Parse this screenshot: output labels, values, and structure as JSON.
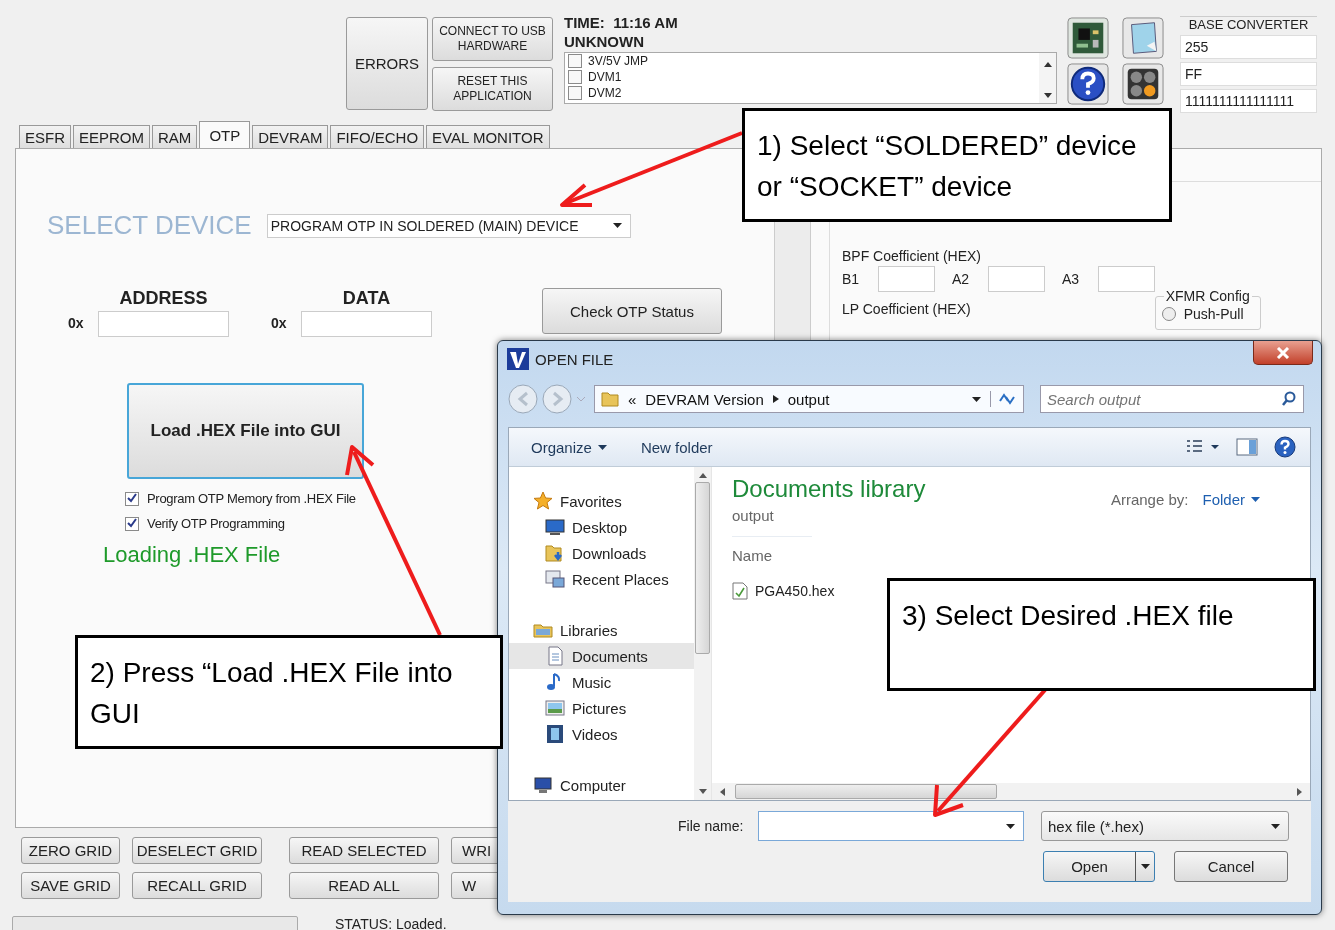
{
  "top_bar": {
    "errors_button": "ERRORS",
    "connect_button": "CONNECT TO USB HARDWARE",
    "reset_button": "RESET THIS APPLICATION",
    "time": "TIME:  11:16 AM",
    "device_state": "UNKNOWN",
    "checklist": [
      {
        "label": "3V/5V JMP",
        "checked": false
      },
      {
        "label": "DVM1",
        "checked": false
      },
      {
        "label": "DVM2",
        "checked": false
      }
    ]
  },
  "base_converter": {
    "title": "BASE CONVERTER",
    "values": [
      "255",
      "FF",
      "1111111111111111"
    ]
  },
  "tabs": [
    {
      "label": "ESFR",
      "selected": false
    },
    {
      "label": "EEPROM",
      "selected": false
    },
    {
      "label": "RAM",
      "selected": false
    },
    {
      "label": "OTP",
      "selected": true
    },
    {
      "label": "DEVRAM",
      "selected": false
    },
    {
      "label": "FIFO/ECHO",
      "selected": false
    },
    {
      "label": "EVAL MONITOR",
      "selected": false
    }
  ],
  "otp_panel": {
    "select_label": "SELECT DEVICE",
    "device_dropdown": "PROGRAM OTP IN SOLDERED (MAIN) DEVICE",
    "address_label": "ADDRESS",
    "data_label": "DATA",
    "address_prefix": "0x",
    "data_prefix": "0x",
    "check_button": "Check OTP Status",
    "load_button": "Load .HEX File into GUI",
    "options": [
      {
        "label": "Program OTP Memory from .HEX File",
        "checked": true
      },
      {
        "label": "Verify OTP Programming",
        "checked": true
      }
    ],
    "loading_message": "Loading .HEX File"
  },
  "filter_panel": {
    "bpf_label": "BPF Coefficient (HEX)",
    "bpf_fields": [
      "B1",
      "A2",
      "A3"
    ],
    "lp_label": "LP Coefficient (HEX)",
    "xfmr_title": "XFMR Config",
    "xfmr_options": [
      {
        "label": "Push-Pull",
        "selected": false
      }
    ]
  },
  "bottom_buttons": [
    {
      "buttons": [
        "ZERO GRID",
        "DESELECT GRID",
        "READ SELECTED",
        "WRI"
      ]
    },
    {
      "buttons": [
        "SAVE GRID",
        "RECALL GRID",
        "READ ALL",
        "W"
      ]
    }
  ],
  "status_bar": {
    "status": "STATUS: Loaded."
  },
  "open_file_dialog": {
    "title": "OPEN FILE",
    "breadcrumb": [
      "DEVRAM Version",
      "output"
    ],
    "breadcrumb_overflow": "«",
    "search": {
      "placeholder": "Search output"
    },
    "toolbar": {
      "organize": "Organize",
      "new_folder": "New folder"
    },
    "nav": [
      {
        "label": "Favorites",
        "selected": false,
        "children": [
          {
            "label": "Desktop",
            "selected": false
          },
          {
            "label": "Downloads",
            "selected": false
          },
          {
            "label": "Recent Places",
            "selected": false
          }
        ]
      },
      {
        "label": "Libraries",
        "selected": false,
        "children": [
          {
            "label": "Documents",
            "selected": true
          },
          {
            "label": "Music",
            "selected": false
          },
          {
            "label": "Pictures",
            "selected": false
          },
          {
            "label": "Videos",
            "selected": false
          }
        ]
      },
      {
        "label": "Computer",
        "selected": false
      }
    ],
    "library_title": "Documents library",
    "library_subtitle": "output",
    "arrange_label": "Arrange by:",
    "arrange_value": "Folder",
    "column_name": "Name",
    "files": [
      {
        "name": "PGA450.hex"
      }
    ],
    "file_name_label": "File name:",
    "file_type": "hex file (*.hex)",
    "open_button": "Open",
    "cancel_button": "Cancel"
  },
  "callouts": [
    {
      "text": "1) Select “SOLDERED” device or “SOCKET” device"
    },
    {
      "text": "2) Press “Load .HEX File into GUI"
    },
    {
      "text": "3) Select Desired .HEX file"
    }
  ]
}
